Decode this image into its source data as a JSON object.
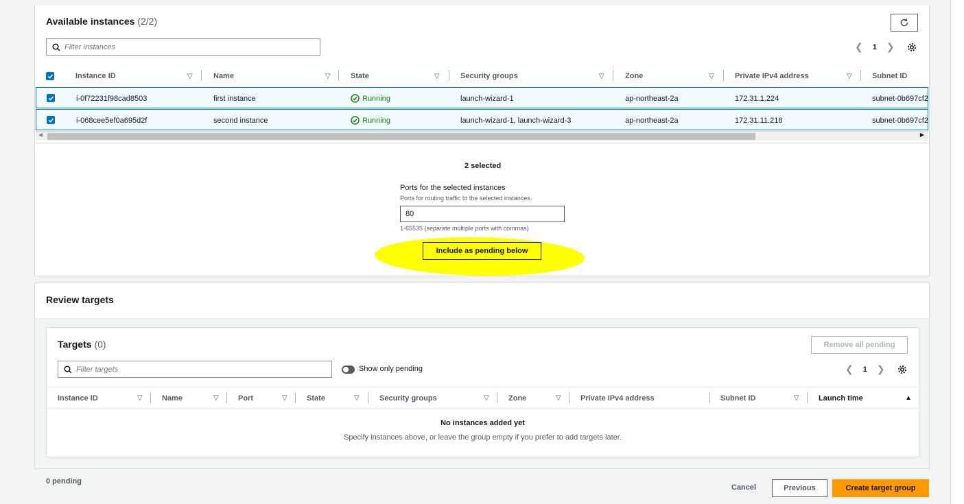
{
  "available": {
    "title": "Available instances",
    "count": "(2/2)",
    "filter_placeholder": "Filter instances",
    "page": "1",
    "columns": [
      "Instance ID",
      "Name",
      "State",
      "Security groups",
      "Zone",
      "Private IPv4 address",
      "Subnet ID"
    ],
    "rows": [
      {
        "id": "i-0f72231f98cad8503",
        "name": "first instance",
        "state": "Running",
        "sg": "launch-wizard-1",
        "zone": "ap-northeast-2a",
        "ip": "172.31.1.224",
        "subnet": "subnet-0b697cf2"
      },
      {
        "id": "i-068cee5ef0a695d2f",
        "name": "second instance",
        "state": "Running",
        "sg": "launch-wizard-1, launch-wizard-3",
        "zone": "ap-northeast-2a",
        "ip": "172.31.11.218",
        "subnet": "subnet-0b697cf2"
      }
    ],
    "selected_text": "2 selected",
    "ports_label": "Ports for the selected instances",
    "ports_desc": "Ports for routing traffic to the selected instances.",
    "ports_value": "80",
    "ports_hint": "1-65535 (separate multiple ports with commas)",
    "include_button": "Include as pending below"
  },
  "review": {
    "title": "Review targets",
    "targets_title": "Targets",
    "targets_count": "(0)",
    "remove_all": "Remove all pending",
    "filter_placeholder": "Filter targets",
    "show_pending": "Show only pending",
    "page": "1",
    "columns": [
      "Instance ID",
      "Name",
      "Port",
      "State",
      "Security groups",
      "Zone",
      "Private IPv4 address",
      "Subnet ID",
      "Launch time"
    ],
    "empty_title": "No instances added yet",
    "empty_desc": "Specify instances above, or leave the group empty if you prefer to add targets later."
  },
  "footer": {
    "pending": "0 pending",
    "cancel": "Cancel",
    "previous": "Previous",
    "create": "Create target group"
  },
  "colors": {
    "accent": "#0073bb",
    "running": "#1d8102",
    "primary_button": "#ff9900",
    "highlight": "#ffff00"
  }
}
